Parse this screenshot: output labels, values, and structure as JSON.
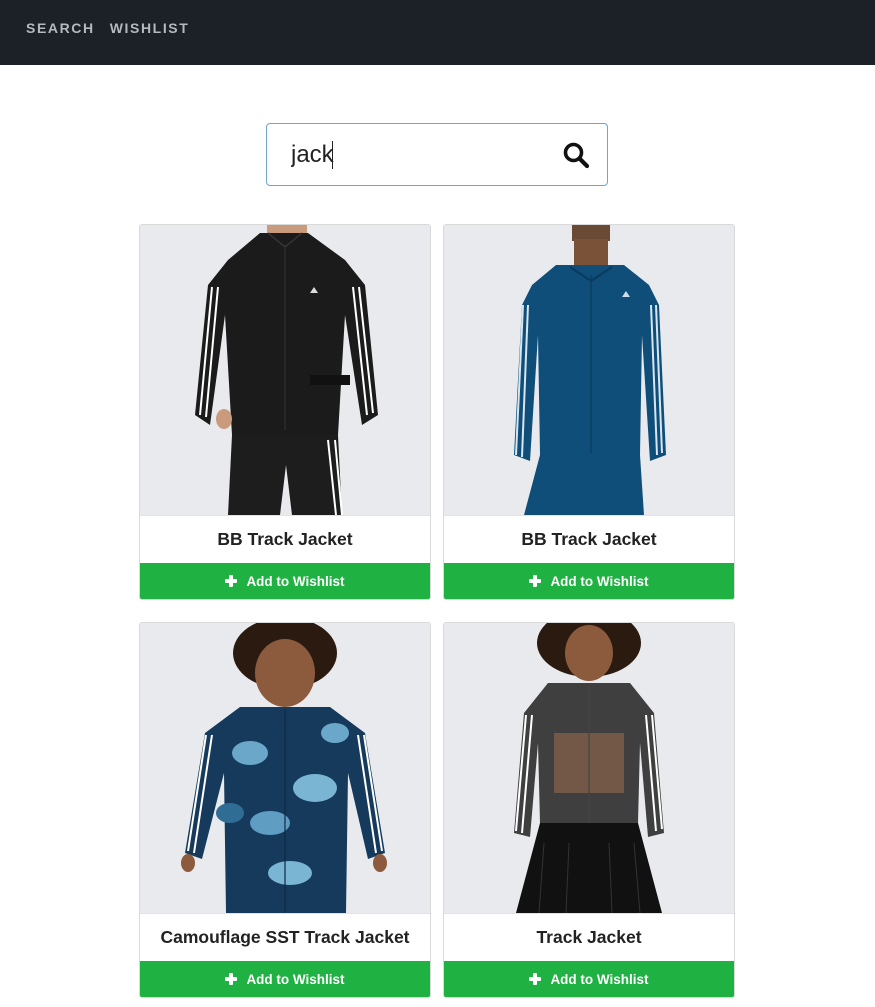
{
  "nav": {
    "items": [
      {
        "label": "SEARCH"
      },
      {
        "label": "WISHLIST"
      }
    ]
  },
  "search": {
    "value": "jack",
    "icon": "search-icon"
  },
  "colors": {
    "navbar_bg": "#1c2128",
    "accent_green": "#1fb141",
    "search_border": "#6fa6c9"
  },
  "products": [
    {
      "title": "BB Track Jacket",
      "button_label": "Add to Wishlist",
      "image": "model wearing black track jacket with white stripes"
    },
    {
      "title": "BB Track Jacket",
      "button_label": "Add to Wishlist",
      "image": "model wearing teal blue track jacket with white stripes"
    },
    {
      "title": "Camouflage SST Track Jacket",
      "button_label": "Add to Wishlist",
      "image": "child wearing blue camouflage track jacket"
    },
    {
      "title": "Track Jacket",
      "button_label": "Add to Wishlist",
      "image": "model wearing sheer black mesh track jacket"
    }
  ]
}
